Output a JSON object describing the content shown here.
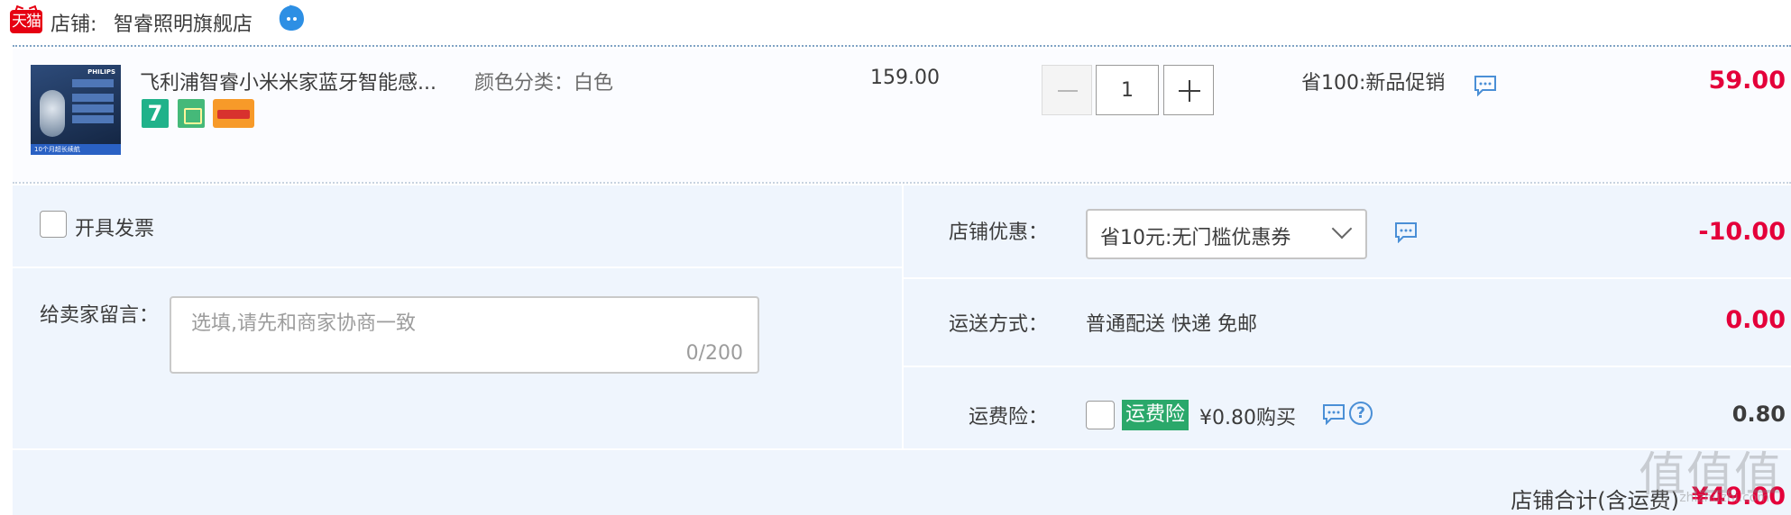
{
  "shop": {
    "label": "店铺:",
    "name": "智睿照明旗舰店",
    "badge_text": "天猫"
  },
  "item": {
    "thumb_brand": "PHILIPS",
    "thumb_caption": "10个月超长续航",
    "title": "飞利浦智睿小米米家蓝牙智能感...",
    "attr": "颜色分类：白色",
    "price": "159.00",
    "quantity": "1",
    "promo": "省100:新品促销",
    "total": "59.00"
  },
  "invoice": {
    "label": "开具发票",
    "checked": false
  },
  "message": {
    "label": "给卖家留言：",
    "placeholder": "选填,请先和商家协商一致",
    "counter": "0/200"
  },
  "shop_discount": {
    "label": "店铺优惠：",
    "selected": "省10元:无门槛优惠券",
    "amount": "-10.00"
  },
  "shipping": {
    "label": "运送方式：",
    "value": "普通配送 快递 免邮",
    "amount": "0.00"
  },
  "insurance": {
    "label": "运费险：",
    "badge": "运费险",
    "price_text": "¥0.80购买",
    "amount": "0.80",
    "checked": false
  },
  "footer": {
    "label": "店铺合计(含运费)",
    "total": "¥49.00"
  },
  "watermark": {
    "text": "值值值",
    "small": "zhizhuzhi.com"
  },
  "colors": {
    "accent_red": "#e4003a",
    "tmall_red": "#e60012",
    "panel_bg": "#eff5fd",
    "insurance_green": "#2aa86a"
  }
}
